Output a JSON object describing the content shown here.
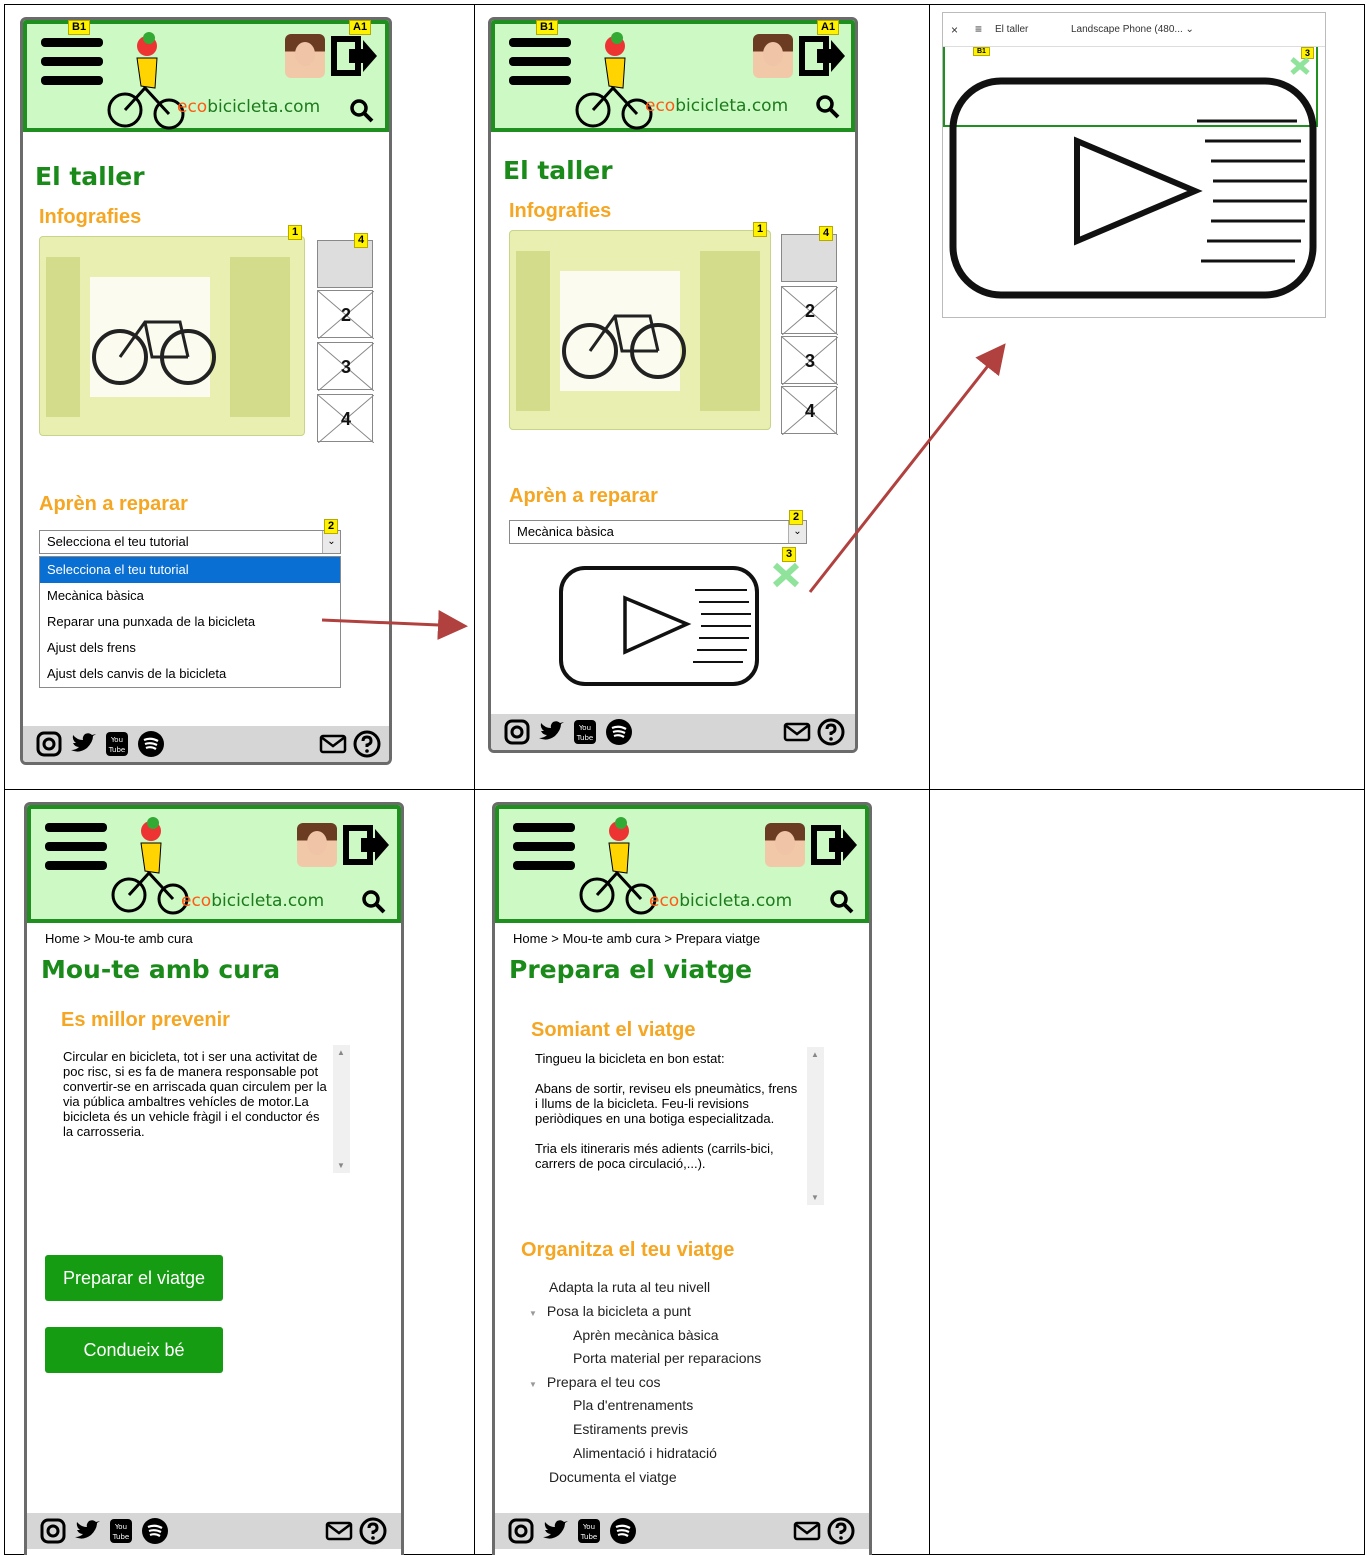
{
  "brand": {
    "eco": "eco",
    "rest": "bicicleta.com"
  },
  "annotations": {
    "b1": "B1",
    "a1": "A1",
    "n1": "1",
    "n2": "2",
    "n3": "3",
    "n4": "4",
    "t2": "2",
    "t3": "3",
    "t4": "4"
  },
  "screen1": {
    "title": "El taller",
    "infographics_heading": "Infografies",
    "repair_heading": "Aprèn a reparar",
    "select_value": "Selecciona el teu tutorial",
    "options": [
      "Selecciona el teu tutorial",
      "Mecànica bàsica",
      "Reparar una punxada de la bicicleta",
      "Ajust dels frens",
      "Ajust dels canvis de la bicicleta"
    ]
  },
  "screen2": {
    "title": "El taller",
    "infographics_heading": "Infografies",
    "repair_heading": "Aprèn a reparar",
    "select_value": "Mecànica bàsica"
  },
  "screen3": {
    "close": "×",
    "tab_title": "El taller",
    "device": "Landscape Phone (480... ⌄",
    "tag_b1": "B1",
    "tag_3": "3"
  },
  "screen4": {
    "breadcrumb": "Home > Mou-te amb cura",
    "title": "Mou-te amb cura",
    "subheading": "Es millor prevenir",
    "text": "Circular en bicicleta, tot i ser una activitat de poc risc, si es fa de manera responsable pot convertir-se en arriscada quan circulem per la via pública ambaltres vehícles de motor.La bicicleta és un vehicle fràgil i el conductor és la carrosseria.",
    "buttons": [
      "Preparar el viatge",
      "Condueix bé"
    ]
  },
  "screen5": {
    "breadcrumb": "Home > Mou-te amb cura > Prepara viatge",
    "title": "Prepara el viatge",
    "subheading": "Somiant el viatge",
    "paragraphs": [
      "Tingueu la bicicleta en bon estat:",
      "Abans de sortir, reviseu els pneumàtics, frens i llums de la bicicleta. Feu-li revisions periòdiques en una botiga especialitzada.",
      "Tria els itineraris més adients (carrils-bici, carrers de poca circulació,...)."
    ],
    "organize_heading": "Organitza el teu viatge",
    "tree": [
      {
        "label": "Adapta la ruta al teu nivell",
        "level": 1
      },
      {
        "label": "Posa la bicicleta a punt",
        "level": 0
      },
      {
        "label": "Aprèn mecànica bàsica",
        "level": 2
      },
      {
        "label": "Porta material per reparacions",
        "level": 2
      },
      {
        "label": "Prepara el teu cos",
        "level": 0
      },
      {
        "label": "Pla d'entrenaments",
        "level": 2
      },
      {
        "label": "Estiraments previs",
        "level": 2
      },
      {
        "label": "Alimentació i hidratació",
        "level": 2
      },
      {
        "label": "Documenta el viatge",
        "level": 1
      }
    ]
  },
  "colors": {
    "header_bg": "#ccf9c4",
    "header_border": "#1f8f1f",
    "title_green": "#1a8a1a",
    "section_orange": "#f5a623",
    "button_green": "#169c12",
    "arrow_red": "#b0413e",
    "select_blue": "#0a6fd2"
  },
  "icons": [
    "menu-icon",
    "logout-icon",
    "search-icon",
    "instagram-icon",
    "twitter-icon",
    "youtube-icon",
    "spotify-icon",
    "mail-icon",
    "help-icon",
    "play-video-icon"
  ]
}
